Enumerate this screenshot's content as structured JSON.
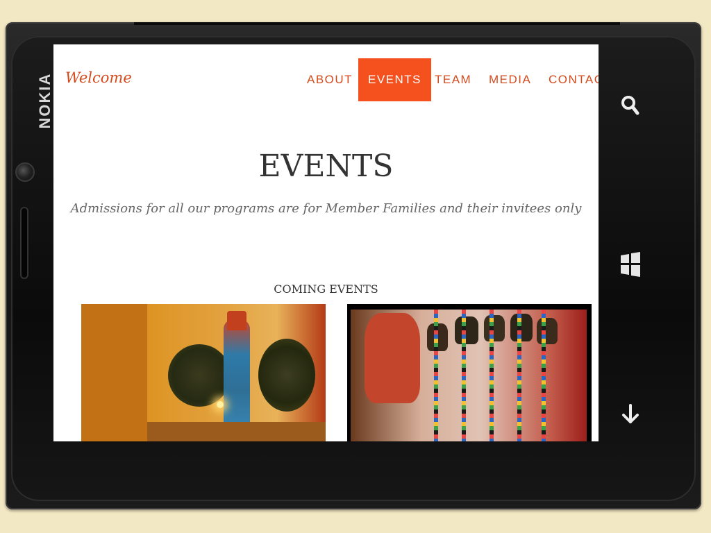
{
  "device": {
    "brand": "NOKIA"
  },
  "site": {
    "logo": "Welcome",
    "nav": [
      {
        "label": "ABOUT",
        "active": false
      },
      {
        "label": "EVENTS",
        "active": true
      },
      {
        "label": "TEAM",
        "active": false
      },
      {
        "label": "MEDIA",
        "active": false
      },
      {
        "label": "CONTACT",
        "active": false
      }
    ],
    "page_title": "EVENTS",
    "subtitle": "Admissions for all our programs are for Member Families and their invitees only",
    "section_label": "COMING EVENTS"
  },
  "colors": {
    "accent": "#f4511e",
    "nav_text": "#d44a1d",
    "background": "#f3e8c4"
  },
  "icons": {
    "search": "search-icon",
    "windows": "windows-icon",
    "back": "down-arrow-icon"
  }
}
